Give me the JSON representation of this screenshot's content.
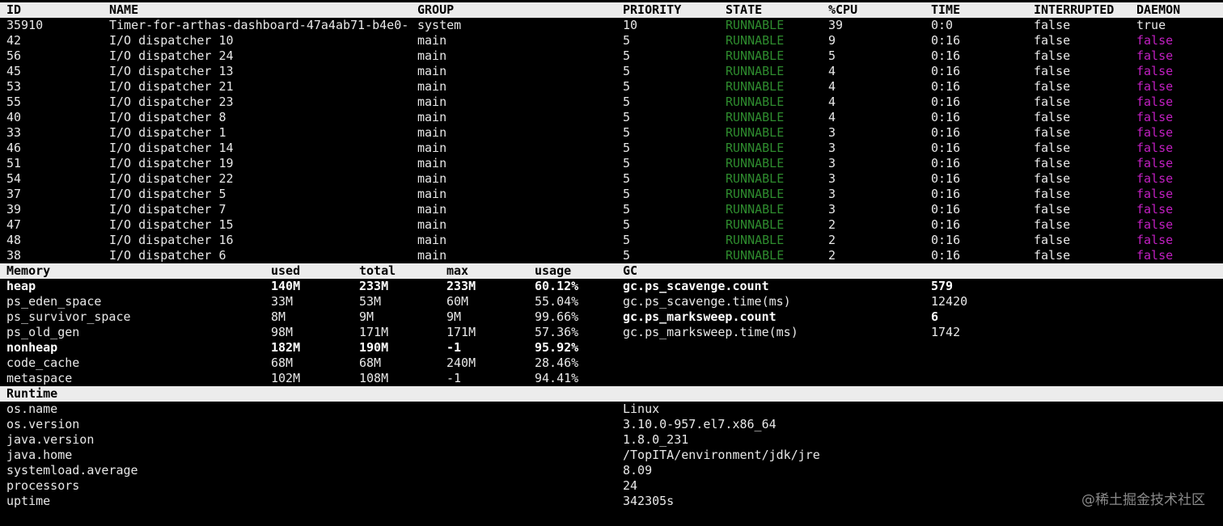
{
  "threads": {
    "headers": {
      "id": "ID",
      "name": "NAME",
      "group": "GROUP",
      "priority": "PRIORITY",
      "state": "STATE",
      "cpu": "%CPU",
      "time": "TIME",
      "interrupted": "INTERRUPTED",
      "daemon": "DAEMON"
    },
    "rows": [
      {
        "id": "35910",
        "name": "Timer-for-arthas-dashboard-47a4ab71-b4e0-",
        "group": "system",
        "priority": "10",
        "state": "RUNNABLE",
        "cpu": "39",
        "time": "0:0",
        "interrupted": "false",
        "daemon": "true"
      },
      {
        "id": "42",
        "name": "I/O dispatcher 10",
        "group": "main",
        "priority": "5",
        "state": "RUNNABLE",
        "cpu": "9",
        "time": "0:16",
        "interrupted": "false",
        "daemon": "false"
      },
      {
        "id": "56",
        "name": "I/O dispatcher 24",
        "group": "main",
        "priority": "5",
        "state": "RUNNABLE",
        "cpu": "5",
        "time": "0:16",
        "interrupted": "false",
        "daemon": "false"
      },
      {
        "id": "45",
        "name": "I/O dispatcher 13",
        "group": "main",
        "priority": "5",
        "state": "RUNNABLE",
        "cpu": "4",
        "time": "0:16",
        "interrupted": "false",
        "daemon": "false"
      },
      {
        "id": "53",
        "name": "I/O dispatcher 21",
        "group": "main",
        "priority": "5",
        "state": "RUNNABLE",
        "cpu": "4",
        "time": "0:16",
        "interrupted": "false",
        "daemon": "false"
      },
      {
        "id": "55",
        "name": "I/O dispatcher 23",
        "group": "main",
        "priority": "5",
        "state": "RUNNABLE",
        "cpu": "4",
        "time": "0:16",
        "interrupted": "false",
        "daemon": "false"
      },
      {
        "id": "40",
        "name": "I/O dispatcher 8",
        "group": "main",
        "priority": "5",
        "state": "RUNNABLE",
        "cpu": "4",
        "time": "0:16",
        "interrupted": "false",
        "daemon": "false"
      },
      {
        "id": "33",
        "name": "I/O dispatcher 1",
        "group": "main",
        "priority": "5",
        "state": "RUNNABLE",
        "cpu": "3",
        "time": "0:16",
        "interrupted": "false",
        "daemon": "false"
      },
      {
        "id": "46",
        "name": "I/O dispatcher 14",
        "group": "main",
        "priority": "5",
        "state": "RUNNABLE",
        "cpu": "3",
        "time": "0:16",
        "interrupted": "false",
        "daemon": "false"
      },
      {
        "id": "51",
        "name": "I/O dispatcher 19",
        "group": "main",
        "priority": "5",
        "state": "RUNNABLE",
        "cpu": "3",
        "time": "0:16",
        "interrupted": "false",
        "daemon": "false"
      },
      {
        "id": "54",
        "name": "I/O dispatcher 22",
        "group": "main",
        "priority": "5",
        "state": "RUNNABLE",
        "cpu": "3",
        "time": "0:16",
        "interrupted": "false",
        "daemon": "false"
      },
      {
        "id": "37",
        "name": "I/O dispatcher 5",
        "group": "main",
        "priority": "5",
        "state": "RUNNABLE",
        "cpu": "3",
        "time": "0:16",
        "interrupted": "false",
        "daemon": "false"
      },
      {
        "id": "39",
        "name": "I/O dispatcher 7",
        "group": "main",
        "priority": "5",
        "state": "RUNNABLE",
        "cpu": "3",
        "time": "0:16",
        "interrupted": "false",
        "daemon": "false"
      },
      {
        "id": "47",
        "name": "I/O dispatcher 15",
        "group": "main",
        "priority": "5",
        "state": "RUNNABLE",
        "cpu": "2",
        "time": "0:16",
        "interrupted": "false",
        "daemon": "false"
      },
      {
        "id": "48",
        "name": "I/O dispatcher 16",
        "group": "main",
        "priority": "5",
        "state": "RUNNABLE",
        "cpu": "2",
        "time": "0:16",
        "interrupted": "false",
        "daemon": "false"
      },
      {
        "id": "38",
        "name": "I/O dispatcher 6",
        "group": "main",
        "priority": "5",
        "state": "RUNNABLE",
        "cpu": "2",
        "time": "0:16",
        "interrupted": "false",
        "daemon": "false"
      }
    ]
  },
  "memory": {
    "headers": {
      "memory": "Memory",
      "used": "used",
      "total": "total",
      "max": "max",
      "usage": "usage",
      "gc": "GC"
    },
    "rows": [
      {
        "name": "heap",
        "used": "140M",
        "total": "233M",
        "max": "233M",
        "usage": "60.12%",
        "bold": true
      },
      {
        "name": "ps_eden_space",
        "used": "33M",
        "total": "53M",
        "max": "60M",
        "usage": "55.04%",
        "bold": false
      },
      {
        "name": "ps_survivor_space",
        "used": "8M",
        "total": "9M",
        "max": "9M",
        "usage": "99.66%",
        "bold": false
      },
      {
        "name": "ps_old_gen",
        "used": "98M",
        "total": "171M",
        "max": "171M",
        "usage": "57.36%",
        "bold": false
      },
      {
        "name": "nonheap",
        "used": "182M",
        "total": "190M",
        "max": "-1",
        "usage": "95.92%",
        "bold": true
      },
      {
        "name": "code_cache",
        "used": "68M",
        "total": "68M",
        "max": "240M",
        "usage": "28.46%",
        "bold": false
      },
      {
        "name": "metaspace",
        "used": "102M",
        "total": "108M",
        "max": "-1",
        "usage": "94.41%",
        "bold": false
      }
    ],
    "gc": [
      {
        "key": "gc.ps_scavenge.count",
        "value": "579",
        "bold": true
      },
      {
        "key": "gc.ps_scavenge.time(ms)",
        "value": "12420",
        "bold": false
      },
      {
        "key": "gc.ps_marksweep.count",
        "value": "6",
        "bold": true
      },
      {
        "key": "gc.ps_marksweep.time(ms)",
        "value": "1742",
        "bold": false
      }
    ]
  },
  "runtime": {
    "header": "Runtime",
    "rows": [
      {
        "key": "os.name",
        "value": "Linux"
      },
      {
        "key": "os.version",
        "value": "3.10.0-957.el7.x86_64"
      },
      {
        "key": "java.version",
        "value": "1.8.0_231"
      },
      {
        "key": "java.home",
        "value": "/TopITA/environment/jdk/jre"
      },
      {
        "key": "systemload.average",
        "value": "8.09"
      },
      {
        "key": "processors",
        "value": "24"
      },
      {
        "key": "uptime",
        "value": "342305s"
      }
    ]
  },
  "watermark": "@稀土掘金技术社区",
  "colors": {
    "state_runnable": "#2e8b2e",
    "daemon_false": "#c21fc2",
    "header_bg": "#ececec"
  }
}
